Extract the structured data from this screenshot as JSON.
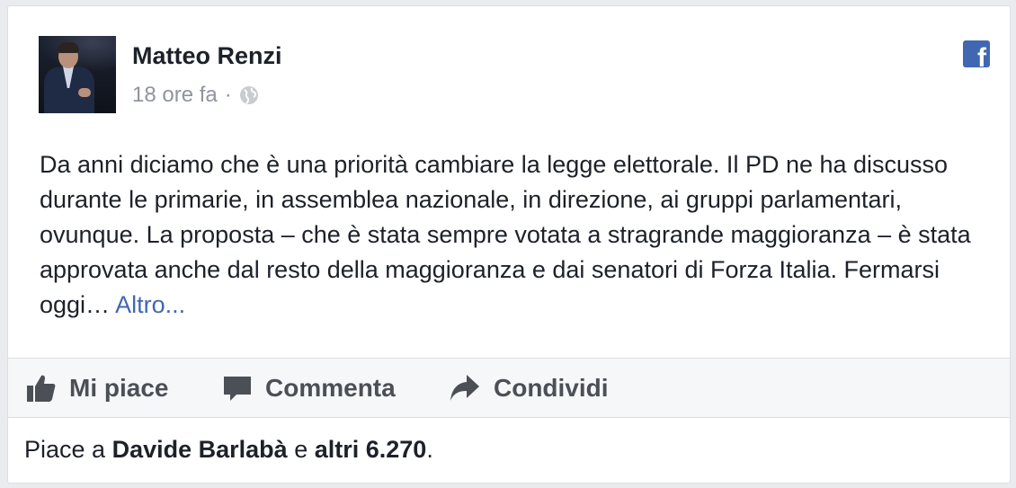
{
  "post": {
    "author": "Matteo Renzi",
    "time": "18 ore fa",
    "separator": "·",
    "privacy_icon": "globe-icon",
    "source_icon": "facebook-icon",
    "source_letter": "f",
    "text": "Da anni diciamo che è una priorità cambiare la legge elettorale. Il PD ne ha discusso durante le primarie, in assemblea nazionale, in direzione, ai gruppi parlamentari, ovunque. La proposta – che è stata sempre votata a stragrande maggioranza – è stata approvata anche dal resto della maggioranza e dai senatori di Forza Italia. Fermarsi oggi…",
    "more_link": "Altro..."
  },
  "actions": {
    "like": {
      "label": "Mi piace",
      "icon": "thumbs-up-icon"
    },
    "comment": {
      "label": "Commenta",
      "icon": "comment-icon"
    },
    "share": {
      "label": "Condividi",
      "icon": "share-arrow-icon"
    }
  },
  "likes": {
    "prefix": "Piace a",
    "person": "Davide Barlabà",
    "conjunction": "e",
    "others": "altri 6.270",
    "suffix": "."
  },
  "colors": {
    "link": "#4267b2",
    "text": "#1d2129",
    "muted": "#90949c",
    "action": "#4b4f56"
  }
}
